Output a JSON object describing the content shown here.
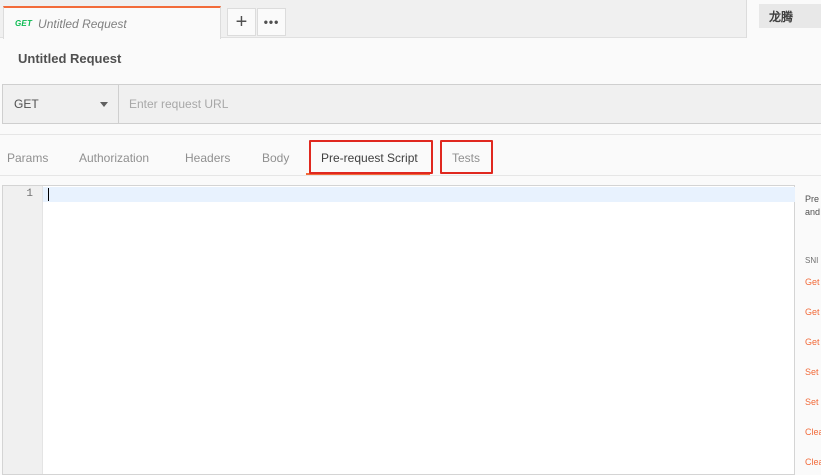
{
  "tabs": [
    {
      "method": "GET",
      "title": "Untitled Request",
      "active": true
    }
  ],
  "tab_actions": {
    "new_tab": "+",
    "more": "•••"
  },
  "environment": {
    "label": "龙腾"
  },
  "request": {
    "title": "Untitled Request",
    "method": "GET",
    "url_value": "",
    "url_placeholder": "Enter request URL"
  },
  "subtabs": [
    {
      "label": "Params"
    },
    {
      "label": "Authorization"
    },
    {
      "label": "Headers"
    },
    {
      "label": "Body"
    },
    {
      "label": "Pre-request Script",
      "active": true,
      "highlighted": true
    },
    {
      "label": "Tests",
      "highlighted": true
    }
  ],
  "editor": {
    "line_numbers": [
      "1"
    ],
    "content": ""
  },
  "snippets_panel": {
    "description_lines": [
      "Pre",
      "and"
    ],
    "heading": "SNI",
    "links": [
      "Get",
      "Get",
      "Get",
      "Set",
      "Set",
      "Clea",
      "Clea"
    ]
  },
  "colors": {
    "accent": "#f26b3a",
    "get_method": "#0cbb52",
    "highlight_box": "#e0281f"
  }
}
